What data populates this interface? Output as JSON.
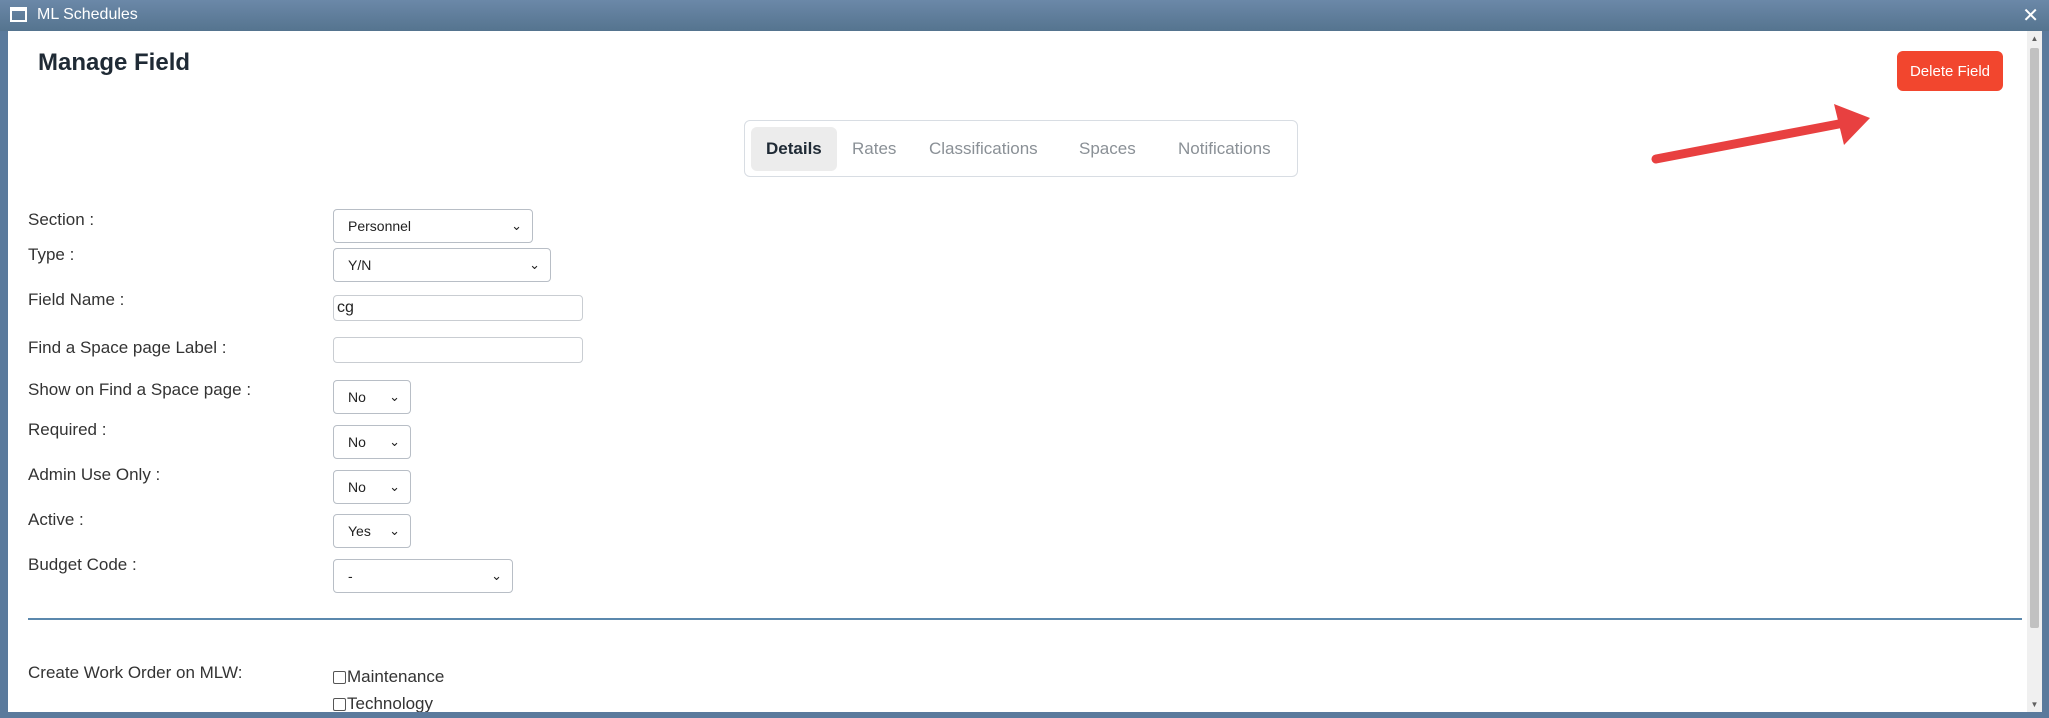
{
  "window": {
    "title": "ML Schedules",
    "close_label": "✕"
  },
  "page": {
    "title": "Manage Field",
    "delete_label": "Delete Field"
  },
  "tabs": [
    "Details",
    "Rates",
    "Classifications",
    "Spaces",
    "Notifications"
  ],
  "active_tab": "Details",
  "form": {
    "section": {
      "label": "Section :",
      "value": "Personnel"
    },
    "type": {
      "label": "Type :",
      "value": "Y/N"
    },
    "field_name": {
      "label": "Field Name :",
      "value": "cg"
    },
    "find_space_label": {
      "label": "Find a Space page Label :",
      "value": ""
    },
    "show_on_find": {
      "label": "Show on Find a Space page :",
      "value": "No"
    },
    "required": {
      "label": "Required :",
      "value": "No"
    },
    "admin_only": {
      "label": "Admin Use Only :",
      "value": "No"
    },
    "active": {
      "label": "Active :",
      "value": "Yes"
    },
    "budget_code": {
      "label": "Budget Code :",
      "value": "-"
    }
  },
  "work_order": {
    "label": "Create Work Order on MLW:",
    "options": [
      "Maintenance",
      "Technology"
    ]
  },
  "colors": {
    "accent": "#f2462e",
    "titlebar": "#5f7e9e",
    "divider": "#5b88ad"
  }
}
